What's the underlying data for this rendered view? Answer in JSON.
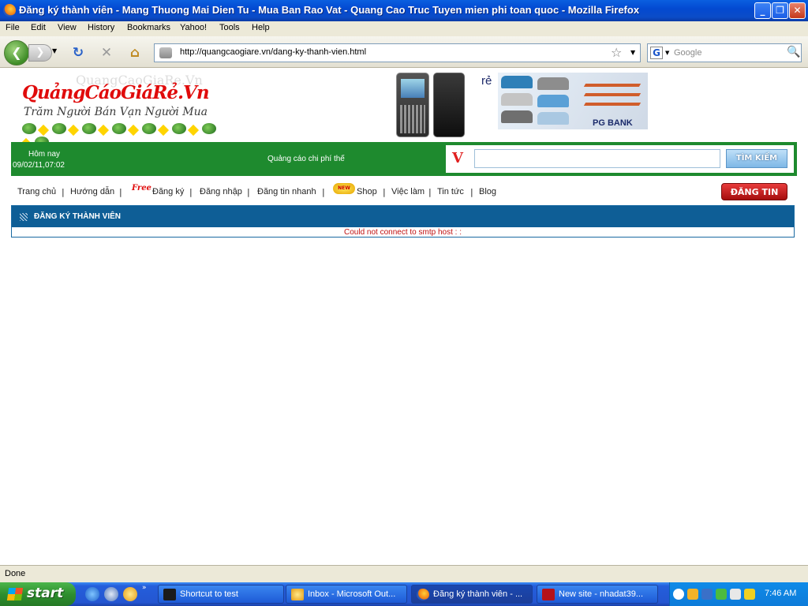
{
  "window": {
    "title": "Đăng ký thành viên - Mang Thuong Mai Dien Tu - Mua Ban Rao Vat - Quang Cao Truc Tuyen mien phi toan quoc - Mozilla Firefox",
    "minimize": "_",
    "maximize": "❐",
    "close": "✕"
  },
  "menu": {
    "file": "File",
    "edit": "Edit",
    "view": "View",
    "history": "History",
    "bookmarks": "Bookmarks",
    "yahoo": "Yahoo!",
    "tools": "Tools",
    "help": "Help"
  },
  "toolbar": {
    "url": "http://quangcaogiare.vn/dang-ky-thanh-vien.html",
    "search_placeholder": "Google"
  },
  "site": {
    "logo_shadow": "QuangCaoGiaRe.Vn",
    "logo": "QuảngCáoGiáRẻ.Vn",
    "slogan": "Trăm Người Bán Vạn Người Mua",
    "ad_text": "rẻ",
    "bank_label": "PG BANK",
    "today_label": "Hôm nay",
    "datetime": "09/02/11,07:02",
    "ad_price_text": "Quảng cáo chi phí thế",
    "search_v": "V",
    "search_button": "TÌM KIẾM",
    "nav": [
      "Trang chủ",
      "Hướng dẫn",
      "Đăng ký",
      "Đăng nhập",
      "Đăng tin nhanh",
      "Shop",
      "Việc làm",
      "Tin tức",
      "Blog"
    ],
    "free_badge": "Free",
    "new_badge": "NEW",
    "post_button": "ĐĂNG TIN",
    "panel_title": "ĐĂNG KÝ THÀNH VIÊN",
    "error_message": "Could not connect to smtp host : :"
  },
  "status": {
    "text": "Done"
  },
  "taskbar": {
    "start": "start",
    "tasks": [
      "Shortcut to test",
      "Inbox - Microsoft Out...",
      "Đăng ký thành viên - ...",
      "New site - nhadat39..."
    ],
    "clock": "7:46 AM"
  },
  "colors": {
    "site_green": "#1e8a2e",
    "panel_blue": "#0e5e96",
    "error_red": "#c01010",
    "logo_red": "#e00b0b"
  }
}
